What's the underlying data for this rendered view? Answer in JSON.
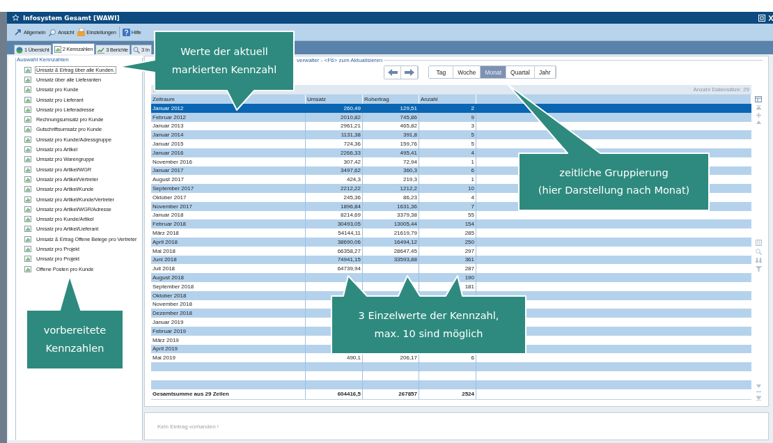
{
  "window": {
    "title": "Infosystem Gesamt [WAWI]"
  },
  "menu": [
    {
      "label": "Allgemein"
    },
    {
      "label": "Ansicht"
    },
    {
      "label": "Einstellungen"
    },
    {
      "label": "Hilfe"
    }
  ],
  "tabs": [
    {
      "label": "1 Übersicht",
      "selected": false
    },
    {
      "label": "2 Kennzahlen",
      "selected": true
    },
    {
      "label": "3 Berichte",
      "selected": false
    },
    {
      "label": "3 In",
      "selected": false
    }
  ],
  "sidebar": {
    "title": "Auswahl Kennzahlen",
    "items": [
      {
        "label": "Umsatz & Ertrag über alle Kunden.",
        "selected": true
      },
      {
        "label": "Umsatz über alle Lieferanten",
        "selected": false
      },
      {
        "label": "Umsatz pro Kunde",
        "selected": false
      },
      {
        "label": "Umsatz pro Lieferant",
        "selected": false
      },
      {
        "label": "Umsatz pro Lieferadresse",
        "selected": false
      },
      {
        "label": "Rechnungsumsatz pro Kunde",
        "selected": false
      },
      {
        "label": "Gutschriftsumsatz pro Kunde",
        "selected": false
      },
      {
        "label": "Umsatz pro Kunde/Adressgruppe",
        "selected": false
      },
      {
        "label": "Umsatz pro Artikel",
        "selected": false
      },
      {
        "label": "Umsatz pro Warengruppe",
        "selected": false
      },
      {
        "label": "Umsatz pro Artikel/WGR",
        "selected": false
      },
      {
        "label": "Umsatz pro Artikel/Vertreter",
        "selected": false
      },
      {
        "label": "Umsatz pro Artikel/Kunde",
        "selected": false
      },
      {
        "label": "Umsatz pro Artikel/Kunde/Vertreter",
        "selected": false
      },
      {
        "label": "Umsatz pro Artikel/WGR/Adresse",
        "selected": false
      },
      {
        "label": "Umsatz pro Kunde/Artikel",
        "selected": false
      },
      {
        "label": "Umsatz pro Artikel/Lieferant",
        "selected": false
      },
      {
        "label": "Umsatz & Ertrag Offene Belege pro Vertreter",
        "selected": false
      },
      {
        "label": "Umsatz pro Projekt",
        "selected": false
      },
      {
        "label": "Umsatz pro Projekt",
        "selected": false
      },
      {
        "label": "Offene Posten pro Kunde",
        "selected": false
      }
    ]
  },
  "panel": {
    "legend": "verwalter - <F6> zum Aktualisieren",
    "periods": [
      {
        "label": "Tag",
        "selected": false
      },
      {
        "label": "Woche",
        "selected": false
      },
      {
        "label": "Monat",
        "selected": true
      },
      {
        "label": "Quartal",
        "selected": false
      },
      {
        "label": "Jahr",
        "selected": false
      }
    ],
    "record_count": "Anzahl Datensätze: 29"
  },
  "table": {
    "columns": [
      "Zeitraum",
      "Umsatz",
      "Rohertrag",
      "Anzahl"
    ],
    "rows": [
      {
        "cells": [
          "Januar 2012",
          "260,49",
          "129,51",
          "2"
        ],
        "selected": true
      },
      {
        "cells": [
          "Februar 2012",
          "2010,82",
          "745,86",
          "9"
        ],
        "selected": false
      },
      {
        "cells": [
          "Januar 2013",
          "2961,21",
          "465,82",
          "3"
        ],
        "selected": false
      },
      {
        "cells": [
          "Januar 2014",
          "1131,38",
          "391,8",
          "5"
        ],
        "selected": false
      },
      {
        "cells": [
          "Januar 2015",
          "724,36",
          "159,76",
          "5"
        ],
        "selected": false
      },
      {
        "cells": [
          "Januar 2016",
          "2266,33",
          "495,41",
          "4"
        ],
        "selected": false
      },
      {
        "cells": [
          "November 2016",
          "307,42",
          "72,94",
          "1"
        ],
        "selected": false
      },
      {
        "cells": [
          "Januar 2017",
          "3497,62",
          "360,3",
          "6"
        ],
        "selected": false
      },
      {
        "cells": [
          "August 2017",
          "424,3",
          "219,3",
          "1"
        ],
        "selected": false
      },
      {
        "cells": [
          "September 2017",
          "2212,22",
          "1212,2",
          "10"
        ],
        "selected": false
      },
      {
        "cells": [
          "Oktober 2017",
          "245,36",
          "86,23",
          "4"
        ],
        "selected": false
      },
      {
        "cells": [
          "November 2017",
          "1896,84",
          "1631,36",
          "7"
        ],
        "selected": false
      },
      {
        "cells": [
          "Januar 2018",
          "8214,69",
          "3379,38",
          "55"
        ],
        "selected": false
      },
      {
        "cells": [
          "Februar 2018",
          "30493,05",
          "13005,44",
          "154"
        ],
        "selected": false
      },
      {
        "cells": [
          "März 2018",
          "54144,11",
          "21619,79",
          "285"
        ],
        "selected": false
      },
      {
        "cells": [
          "April 2018",
          "38690,06",
          "16494,12",
          "250"
        ],
        "selected": false
      },
      {
        "cells": [
          "Mai 2018",
          "66358,27",
          "28647,45",
          "297"
        ],
        "selected": false
      },
      {
        "cells": [
          "Juni 2018",
          "74941,15",
          "33593,88",
          "361"
        ],
        "selected": false
      },
      {
        "cells": [
          "Juli 2018",
          "64739,94",
          null,
          "287"
        ],
        "selected": false
      },
      {
        "cells": [
          "August 2018",
          null,
          null,
          "190"
        ],
        "selected": false
      },
      {
        "cells": [
          "September 2018",
          null,
          null,
          "181"
        ],
        "selected": false
      },
      {
        "cells": [
          "Oktober 2018",
          null,
          null,
          null
        ],
        "selected": false
      },
      {
        "cells": [
          "November 2018",
          null,
          null,
          null
        ],
        "selected": false
      },
      {
        "cells": [
          "Dezember 2018",
          null,
          null,
          null
        ],
        "selected": false
      },
      {
        "cells": [
          "Januar 2019",
          null,
          null,
          null
        ],
        "selected": false
      },
      {
        "cells": [
          "Februar 2019",
          null,
          null,
          null
        ],
        "selected": false
      },
      {
        "cells": [
          "März 2019",
          null,
          null,
          null
        ],
        "selected": false
      },
      {
        "cells": [
          "April 2019",
          null,
          null,
          null
        ],
        "selected": false
      },
      {
        "cells": [
          "Mai 2019",
          "490,1",
          "206,17",
          "6"
        ],
        "selected": false
      }
    ],
    "total": [
      "Gesamtsumme aus 29 Zeilen",
      "604416,5",
      "267857",
      "2524"
    ]
  },
  "detail": {
    "message": "Kein Eintrag vorhanden !"
  },
  "callouts": [
    {
      "text": "Werte der aktuell\nmarkierten Kennzahl"
    },
    {
      "text": "zeitliche Gruppierung\n(hier Darstellung nach Monat)"
    },
    {
      "text": "3 Einzelwerte der Kennzahl,\nmax. 10 sind möglich"
    },
    {
      "text": "vorbereitete\nKennzahlen"
    }
  ]
}
